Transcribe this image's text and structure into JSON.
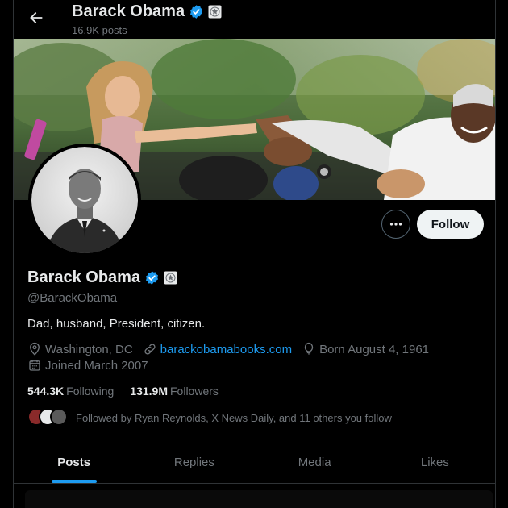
{
  "header": {
    "name": "Barack Obama",
    "posts_count": "16.9K posts"
  },
  "profile": {
    "display_name": "Barack Obama",
    "handle": "@BarackObama",
    "bio": "Dad, husband, President, citizen.",
    "location": "Washington, DC",
    "website": "barackobamabooks.com",
    "born": "Born August 4, 1961",
    "joined": "Joined March 2007",
    "following_count": "544.3K",
    "following_label": "Following",
    "followers_count": "131.9M",
    "followers_label": "Followers",
    "followed_by": "Followed by Ryan Reynolds, X News Daily, and 11 others you follow"
  },
  "actions": {
    "follow_label": "Follow"
  },
  "tabs": [
    {
      "label": "Posts",
      "active": true
    },
    {
      "label": "Replies",
      "active": false
    },
    {
      "label": "Media",
      "active": false
    },
    {
      "label": "Likes",
      "active": false
    }
  ],
  "icons": {
    "back": "arrow-left-icon",
    "verified": "verified-badge-icon",
    "affiliate": "government-seal-icon",
    "more": "more-horizontal-icon",
    "location": "location-pin-icon",
    "link": "link-icon",
    "born": "balloon-icon",
    "joined": "calendar-icon"
  },
  "colors": {
    "background": "#000000",
    "accent": "#1d9bf0",
    "text_primary": "#e7e9ea",
    "text_secondary": "#71767b",
    "follow_button_bg": "#eff3f4"
  }
}
